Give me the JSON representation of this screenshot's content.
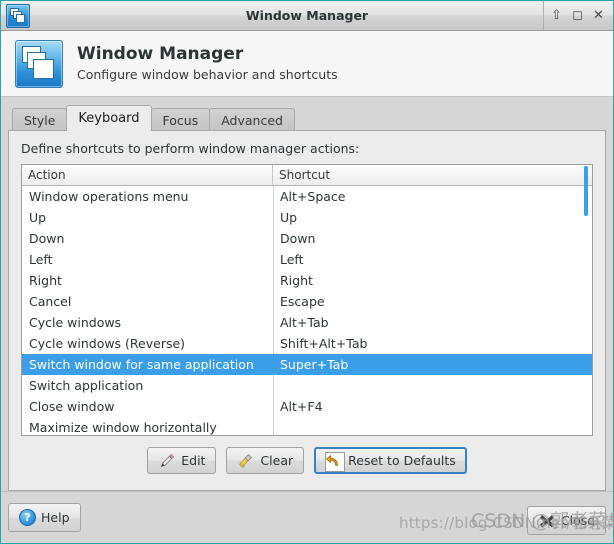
{
  "titlebar": {
    "title": "Window Manager",
    "icon": "window-manager-icon",
    "buttons": [
      {
        "name": "shade-button",
        "glyph": "⇧"
      },
      {
        "name": "maximize-button",
        "glyph": "◻"
      },
      {
        "name": "close-button",
        "glyph": "✕"
      }
    ]
  },
  "header": {
    "icon": "window-manager-icon",
    "title": "Window Manager",
    "subtitle": "Configure window behavior and shortcuts"
  },
  "tabs": [
    {
      "label": "Style",
      "active": false
    },
    {
      "label": "Keyboard",
      "active": true
    },
    {
      "label": "Focus",
      "active": false
    },
    {
      "label": "Advanced",
      "active": false
    }
  ],
  "panel": {
    "description": "Define shortcuts to perform window manager actions:",
    "columns": [
      "Action",
      "Shortcut"
    ],
    "rows": [
      {
        "action": "Window operations menu",
        "shortcut": "Alt+Space",
        "selected": false
      },
      {
        "action": "Up",
        "shortcut": "Up",
        "selected": false
      },
      {
        "action": "Down",
        "shortcut": "Down",
        "selected": false
      },
      {
        "action": "Left",
        "shortcut": "Left",
        "selected": false
      },
      {
        "action": "Right",
        "shortcut": "Right",
        "selected": false
      },
      {
        "action": "Cancel",
        "shortcut": "Escape",
        "selected": false
      },
      {
        "action": "Cycle windows",
        "shortcut": "Alt+Tab",
        "selected": false
      },
      {
        "action": "Cycle windows (Reverse)",
        "shortcut": "Shift+Alt+Tab",
        "selected": false
      },
      {
        "action": "Switch window for same application",
        "shortcut": "Super+Tab",
        "selected": true
      },
      {
        "action": "Switch application",
        "shortcut": "",
        "selected": false
      },
      {
        "action": "Close window",
        "shortcut": "Alt+F4",
        "selected": false
      },
      {
        "action": "Maximize window horizontally",
        "shortcut": "",
        "selected": false
      }
    ],
    "scrollbar": {
      "color": "#3b9ee8"
    }
  },
  "actions": [
    {
      "name": "edit-button",
      "label": "Edit",
      "icon": "pencil-icon",
      "focused": false
    },
    {
      "name": "clear-button",
      "label": "Clear",
      "icon": "broom-icon",
      "focused": false
    },
    {
      "name": "reset-button",
      "label": "Reset to Defaults",
      "icon": "undo-arrow-icon",
      "focused": true
    }
  ],
  "footer": {
    "help_label": "Help",
    "help_icon": "question-mark-icon",
    "close_label": "Close",
    "close_icon": "close-x-icon"
  },
  "watermark": {
    "url": "https://blog.CSDN.net/郭老菜鸟",
    "overlay": "CSDN @郭老菜鸟"
  },
  "colors": {
    "selection": "#3b9ee8",
    "window_border": "#2aa5a5",
    "panel_bg": "#ececec",
    "frame_bg": "#d6d6d6"
  }
}
